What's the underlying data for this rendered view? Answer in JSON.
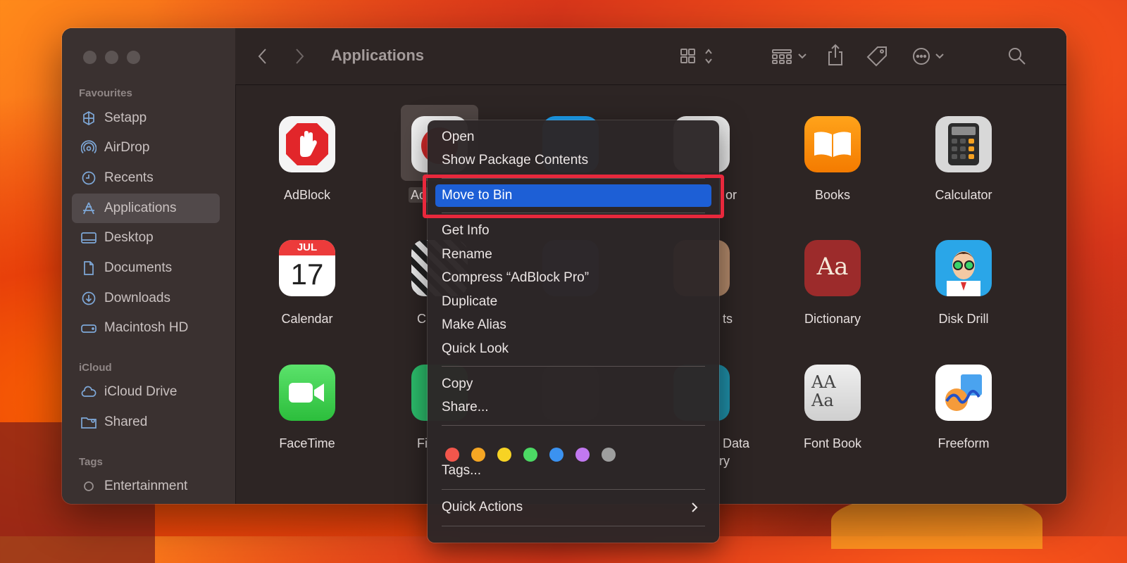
{
  "window": {
    "title": "Applications"
  },
  "sidebar": {
    "favourites_header": "Favourites",
    "favourites": [
      {
        "label": "Setapp",
        "icon": "setapp-icon"
      },
      {
        "label": "AirDrop",
        "icon": "airdrop-icon"
      },
      {
        "label": "Recents",
        "icon": "clock-icon"
      },
      {
        "label": "Applications",
        "icon": "applications-icon",
        "selected": true
      },
      {
        "label": "Desktop",
        "icon": "desktop-icon"
      },
      {
        "label": "Documents",
        "icon": "document-icon"
      },
      {
        "label": "Downloads",
        "icon": "download-icon"
      },
      {
        "label": "Macintosh HD",
        "icon": "drive-icon"
      }
    ],
    "icloud_header": "iCloud",
    "icloud": [
      {
        "label": "iCloud Drive",
        "icon": "cloud-icon"
      },
      {
        "label": "Shared",
        "icon": "shared-folder-icon"
      }
    ],
    "tags_header": "Tags",
    "tags": [
      {
        "label": "Entertainment",
        "icon": "tag-circle-icon"
      }
    ]
  },
  "apps": [
    {
      "label": "AdBlock"
    },
    {
      "label": "Ad",
      "selected": true
    },
    {
      "label": ""
    },
    {
      "label": "or"
    },
    {
      "label": "Books"
    },
    {
      "label": "Calculator"
    },
    {
      "label": "Calendar",
      "icon_month": "JUL",
      "icon_day": "17"
    },
    {
      "label": "C"
    },
    {
      "label": ""
    },
    {
      "label": "ts"
    },
    {
      "label": "Dictionary",
      "icon_text": "Aa"
    },
    {
      "label": "Disk Drill"
    },
    {
      "label": "FaceTime"
    },
    {
      "label": "Fi"
    },
    {
      "label": ""
    },
    {
      "label": "Data",
      "label2": "ry"
    },
    {
      "label": "Font Book",
      "icon_text": "AA Aa"
    },
    {
      "label": "Freeform"
    }
  ],
  "context_menu": {
    "items": [
      {
        "label": "Open"
      },
      {
        "label": "Show Package Contents"
      },
      {
        "label": "Move to Bin",
        "highlighted": true
      },
      {
        "label": "Get Info"
      },
      {
        "label": "Rename"
      },
      {
        "label": "Compress “AdBlock Pro”"
      },
      {
        "label": "Duplicate"
      },
      {
        "label": "Make Alias"
      },
      {
        "label": "Quick Look"
      },
      {
        "label": "Copy"
      },
      {
        "label": "Share..."
      },
      {
        "label": "Tags..."
      },
      {
        "label": "Quick Actions",
        "submenu": true
      }
    ],
    "tag_colors": [
      "#f2564c",
      "#f5a623",
      "#f7d324",
      "#4cd964",
      "#3b92f0",
      "#c178f0",
      "#9e9e9e"
    ],
    "highlight_color": "#1d5fd6",
    "annotation_color": "#e8283c"
  }
}
